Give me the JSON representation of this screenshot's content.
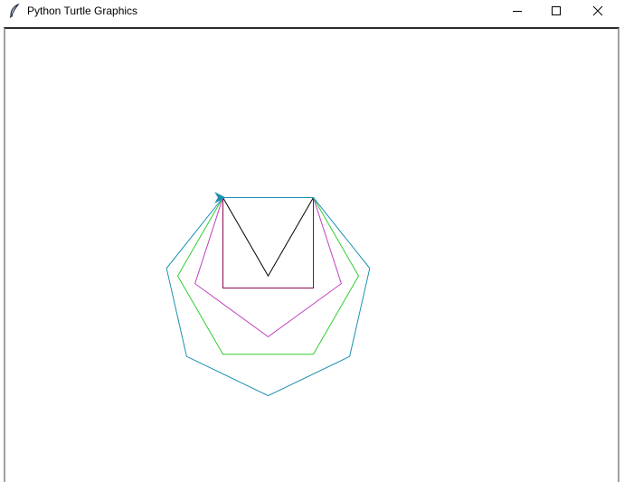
{
  "window": {
    "title": "Python Turtle Graphics",
    "icon": "feather-icon",
    "controls": {
      "minimize": "minimize-icon",
      "maximize": "maximize-icon",
      "close": "close-icon"
    }
  },
  "drawing": {
    "background": "#ffffff",
    "shapes": [
      {
        "name": "triangle",
        "sides": 3,
        "color": "#000000"
      },
      {
        "name": "square",
        "sides": 4,
        "color": "#8b0a50"
      },
      {
        "name": "pentagon",
        "sides": 5,
        "color": "#c040c0"
      },
      {
        "name": "hexagon",
        "sides": 6,
        "color": "#32cd32"
      },
      {
        "name": "heptagon",
        "sides": 7,
        "color": "#1a8fb0"
      }
    ],
    "side_length": 100,
    "turtle": {
      "shape": "arrow",
      "color": "#1a8fb0",
      "heading": "east"
    }
  }
}
